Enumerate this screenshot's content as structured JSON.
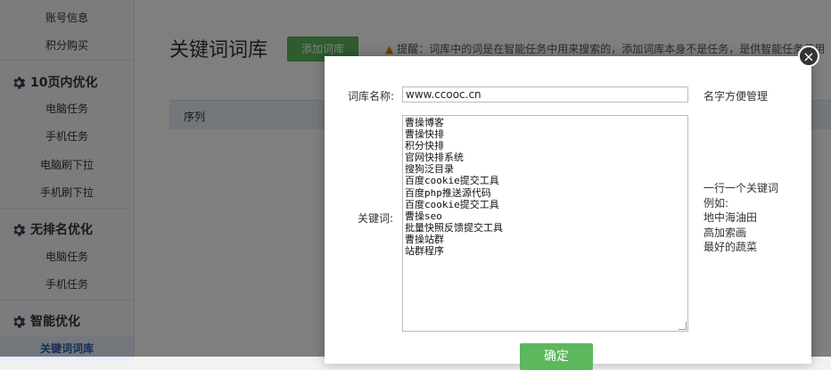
{
  "sidebar": {
    "sections": [
      {
        "items": [
          "账号信息",
          "积分购买"
        ]
      },
      {
        "title": "10页内优化",
        "items": [
          "电脑任务",
          "手机任务",
          "电脑刷下拉",
          "手机刷下拉"
        ]
      },
      {
        "title": "无排名优化",
        "items": [
          "电脑任务",
          "手机任务"
        ]
      },
      {
        "title": "智能优化",
        "items": [
          "关键词词库"
        ]
      }
    ],
    "active_item": "关键词词库"
  },
  "page": {
    "title": "关键词词库",
    "add_button": "添加词库",
    "tip": "提醒：词库中的词是在智能任务中用来搜索的，添加词库本身不是任务，是供智能任务使用",
    "table_header": "序列"
  },
  "modal": {
    "name_label": "词库名称:",
    "name_value": "www.ccooc.cn",
    "name_hint": "名字方便管理",
    "keywords_label": "关键词:",
    "keywords": [
      "曹操博客",
      "曹操快排",
      "积分快排",
      "官网快排系统",
      "搜狗泛目录",
      "百度cookie提交工具",
      "百度php推送源代码",
      "百度cookie提交工具",
      "曹操seo",
      "批量快照反馈提交工具",
      "曹操站群",
      "站群程序"
    ],
    "keywords_hint": [
      "一行一个关键词",
      "例如:",
      "地中海油田",
      "高加索画",
      "最好的蔬菜"
    ],
    "ok_button": "确定",
    "close_icon": "×"
  },
  "colors": {
    "accent_green": "#5cb85c",
    "active_blue": "#2a5db0",
    "warning": "#e07b00"
  }
}
